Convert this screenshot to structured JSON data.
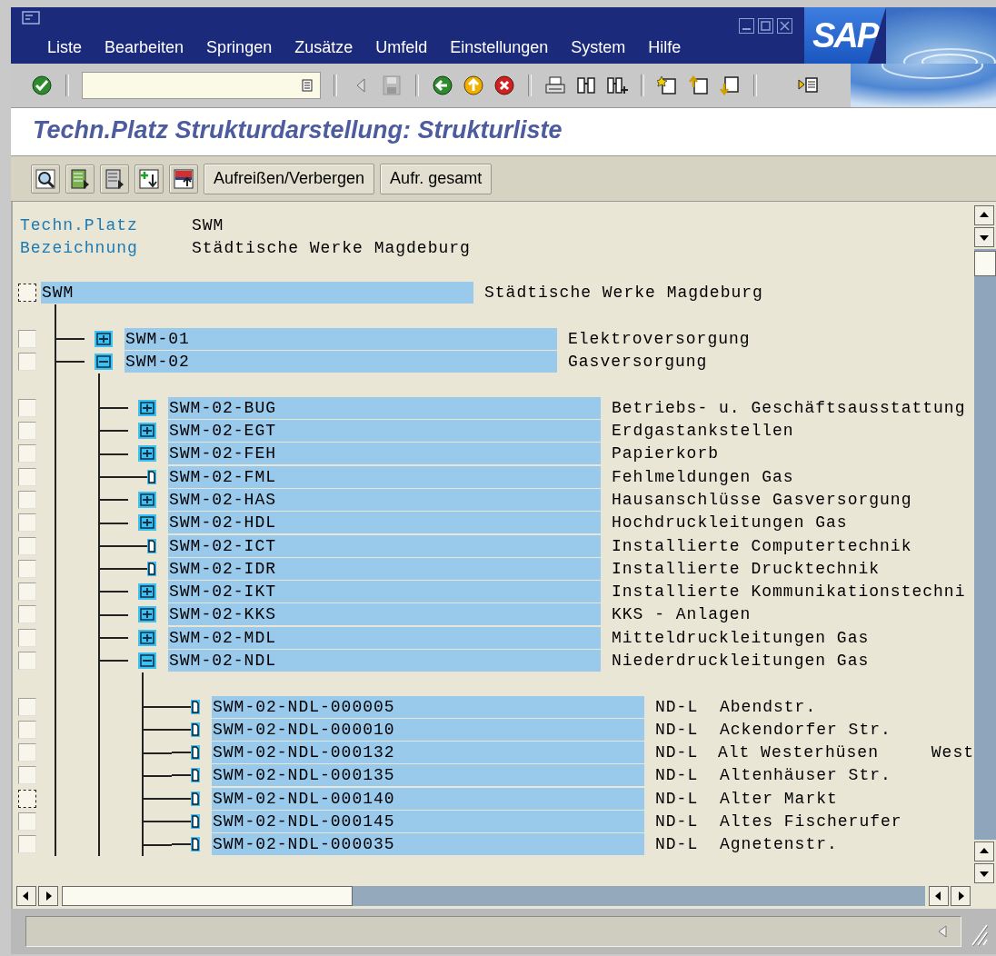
{
  "window": {
    "menu": [
      "Liste",
      "Bearbeiten",
      "Springen",
      "Zusätze",
      "Umfeld",
      "Einstellungen",
      "System",
      "Hilfe"
    ],
    "logo": "SAP"
  },
  "standard_toolbar": [
    {
      "kind": "enter",
      "disabled": false
    },
    {
      "kind": "separator"
    },
    {
      "kind": "command"
    },
    {
      "kind": "separator"
    },
    {
      "kind": "hide",
      "disabled": false
    },
    {
      "kind": "save",
      "disabled": true
    },
    {
      "kind": "separator"
    },
    {
      "kind": "back",
      "disabled": false
    },
    {
      "kind": "exit",
      "disabled": false
    },
    {
      "kind": "cancel",
      "disabled": false
    },
    {
      "kind": "separator"
    },
    {
      "kind": "print",
      "disabled": false
    },
    {
      "kind": "find",
      "disabled": false
    },
    {
      "kind": "findnext",
      "disabled": false
    },
    {
      "kind": "separator"
    },
    {
      "kind": "firstpage",
      "disabled": false
    },
    {
      "kind": "prevpage",
      "disabled": false
    },
    {
      "kind": "nextpage",
      "disabled": false
    },
    {
      "kind": "separator"
    },
    {
      "kind": "layout",
      "disabled": false
    }
  ],
  "title": "Techn.Platz Strukturdarstellung: Strukturliste",
  "application_toolbar": {
    "icon_buttons": [
      {
        "kind": "detail"
      },
      {
        "kind": "selectall"
      },
      {
        "kind": "deselectall"
      },
      {
        "kind": "expand"
      },
      {
        "kind": "collapse"
      }
    ],
    "buttons": [
      "Aufreißen/Verbergen",
      "Aufr. gesamt"
    ]
  },
  "header_fields": [
    {
      "label": "Techn.Platz",
      "value": "SWM"
    },
    {
      "label": "Bezeichnung",
      "value": "Städtische Werke Magdeburg"
    }
  ],
  "tree": {
    "id": "SWM",
    "description": "Städtische Werke Magdeburg",
    "checked": false,
    "focused": true,
    "kind": "root",
    "children": [
      {
        "id": "SWM-01",
        "description": "Elektroversorgung",
        "checked": false,
        "focused": false,
        "kind": "folder",
        "expanded": false
      },
      {
        "id": "SWM-02",
        "description": "Gasversorgung",
        "checked": false,
        "focused": false,
        "kind": "folder",
        "expanded": true,
        "children": [
          {
            "id": "SWM-02-BUG",
            "description": "Betriebs- u. Geschäftsausstattung",
            "checked": false,
            "focused": false,
            "kind": "folder",
            "expanded": false
          },
          {
            "id": "SWM-02-EGT",
            "description": "Erdgastankstellen",
            "checked": false,
            "focused": false,
            "kind": "folder",
            "expanded": false
          },
          {
            "id": "SWM-02-FEH",
            "description": "Papierkorb",
            "checked": false,
            "focused": false,
            "kind": "folder",
            "expanded": false
          },
          {
            "id": "SWM-02-FML",
            "description": "Fehlmeldungen Gas",
            "checked": false,
            "focused": false,
            "kind": "leaf"
          },
          {
            "id": "SWM-02-HAS",
            "description": "Hausanschlüsse Gasversorgung",
            "checked": false,
            "focused": false,
            "kind": "folder",
            "expanded": false
          },
          {
            "id": "SWM-02-HDL",
            "description": "Hochdruckleitungen Gas",
            "checked": false,
            "focused": false,
            "kind": "folder",
            "expanded": false
          },
          {
            "id": "SWM-02-ICT",
            "description": "Installierte Computertechnik",
            "checked": false,
            "focused": false,
            "kind": "leaf"
          },
          {
            "id": "SWM-02-IDR",
            "description": "Installierte Drucktechnik",
            "checked": false,
            "focused": false,
            "kind": "leaf"
          },
          {
            "id": "SWM-02-IKT",
            "description": "Installierte Kommunikationstechni",
            "checked": false,
            "focused": false,
            "kind": "folder",
            "expanded": false
          },
          {
            "id": "SWM-02-KKS",
            "description": "KKS - Anlagen",
            "checked": false,
            "focused": false,
            "kind": "folder",
            "expanded": false
          },
          {
            "id": "SWM-02-MDL",
            "description": "Mitteldruckleitungen Gas",
            "checked": false,
            "focused": false,
            "kind": "folder",
            "expanded": false
          },
          {
            "id": "SWM-02-NDL",
            "description": "Niederdruckleitungen Gas",
            "checked": false,
            "focused": false,
            "kind": "folder",
            "expanded": true,
            "children": [
              {
                "id": "SWM-02-NDL-000005",
                "code": "ND-L",
                "description": "Abendstr.",
                "checked": false,
                "focused": false,
                "kind": "leaf"
              },
              {
                "id": "SWM-02-NDL-000010",
                "code": "ND-L",
                "description": "Ackendorfer Str.",
                "checked": false,
                "focused": false,
                "kind": "leaf"
              },
              {
                "id": "SWM-02-NDL-000132",
                "code": "ND-L",
                "description": "Alt Westerhüsen",
                "column_3": "West",
                "checked": false,
                "focused": false,
                "kind": "leaf"
              },
              {
                "id": "SWM-02-NDL-000135",
                "code": "ND-L",
                "description": "Altenhäuser Str.",
                "checked": false,
                "focused": false,
                "kind": "leaf"
              },
              {
                "id": "SWM-02-NDL-000140",
                "code": "ND-L",
                "description": "Alter Markt",
                "checked": false,
                "focused": true,
                "kind": "leaf"
              },
              {
                "id": "SWM-02-NDL-000145",
                "code": "ND-L",
                "description": "Altes Fischerufer",
                "checked": false,
                "focused": false,
                "kind": "leaf"
              },
              {
                "id": "SWM-02-NDL-000035",
                "code": "ND-L",
                "description": "Agnetenstr.",
                "checked": false,
                "focused": false,
                "kind": "leaf"
              }
            ]
          }
        ]
      }
    ]
  }
}
